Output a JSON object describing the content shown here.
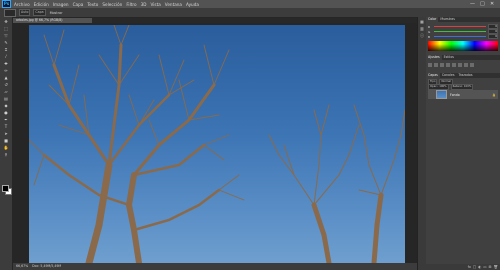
{
  "app": {
    "logo": "Ps",
    "menu": [
      "Archivo",
      "Edición",
      "Imagen",
      "Capa",
      "Texto",
      "Selección",
      "Filtro",
      "3D",
      "Vista",
      "Ventana",
      "Ayuda"
    ]
  },
  "window": {
    "minimize": "—",
    "maximize": "□",
    "close": "✕"
  },
  "options": {
    "preset_icon": "move-icon",
    "field1": "Auto",
    "field2": "Capa",
    "label": "Mostrar"
  },
  "document": {
    "tab_title": "arboles.jpg @ 66,7% (RGB/8)",
    "zoom": "66,67%",
    "doc_info": "Doc: 5,49M/5,49M"
  },
  "tools": [
    "move",
    "marquee",
    "lasso",
    "quick-select",
    "crop",
    "eyedropper",
    "healing",
    "brush",
    "stamp",
    "history-brush",
    "eraser",
    "gradient",
    "blur",
    "dodge",
    "pen",
    "type",
    "path-select",
    "shape",
    "hand",
    "zoom"
  ],
  "panels": {
    "color_tabs": [
      "Color",
      "Muestras"
    ],
    "color_sliders": [
      {
        "label": "R",
        "value": "0",
        "color": "#d94040"
      },
      {
        "label": "G",
        "value": "0",
        "color": "#3fbf3f"
      },
      {
        "label": "B",
        "value": "0",
        "color": "#3f6fd9"
      }
    ],
    "adjust_tabs": [
      "Ajustes",
      "Estilos"
    ],
    "layers_tabs": [
      "Capas",
      "Canales",
      "Trazados"
    ],
    "layer_fields": [
      "Tipo",
      "Normal",
      "Opac.: 100%",
      "Relleno: 100%"
    ],
    "layers": [
      {
        "name": "Fondo",
        "lock": "🔒"
      }
    ],
    "footer_icons": [
      "fx",
      "□",
      "◐",
      "▭",
      "⊞",
      "🗑"
    ]
  },
  "colors": {
    "menubar": "#535353",
    "workspace": "#262626",
    "panel": "#404040",
    "sky_top": "#2a5d9c",
    "sky_bottom": "#6f9fcf",
    "branches": "#8a6a4a"
  }
}
